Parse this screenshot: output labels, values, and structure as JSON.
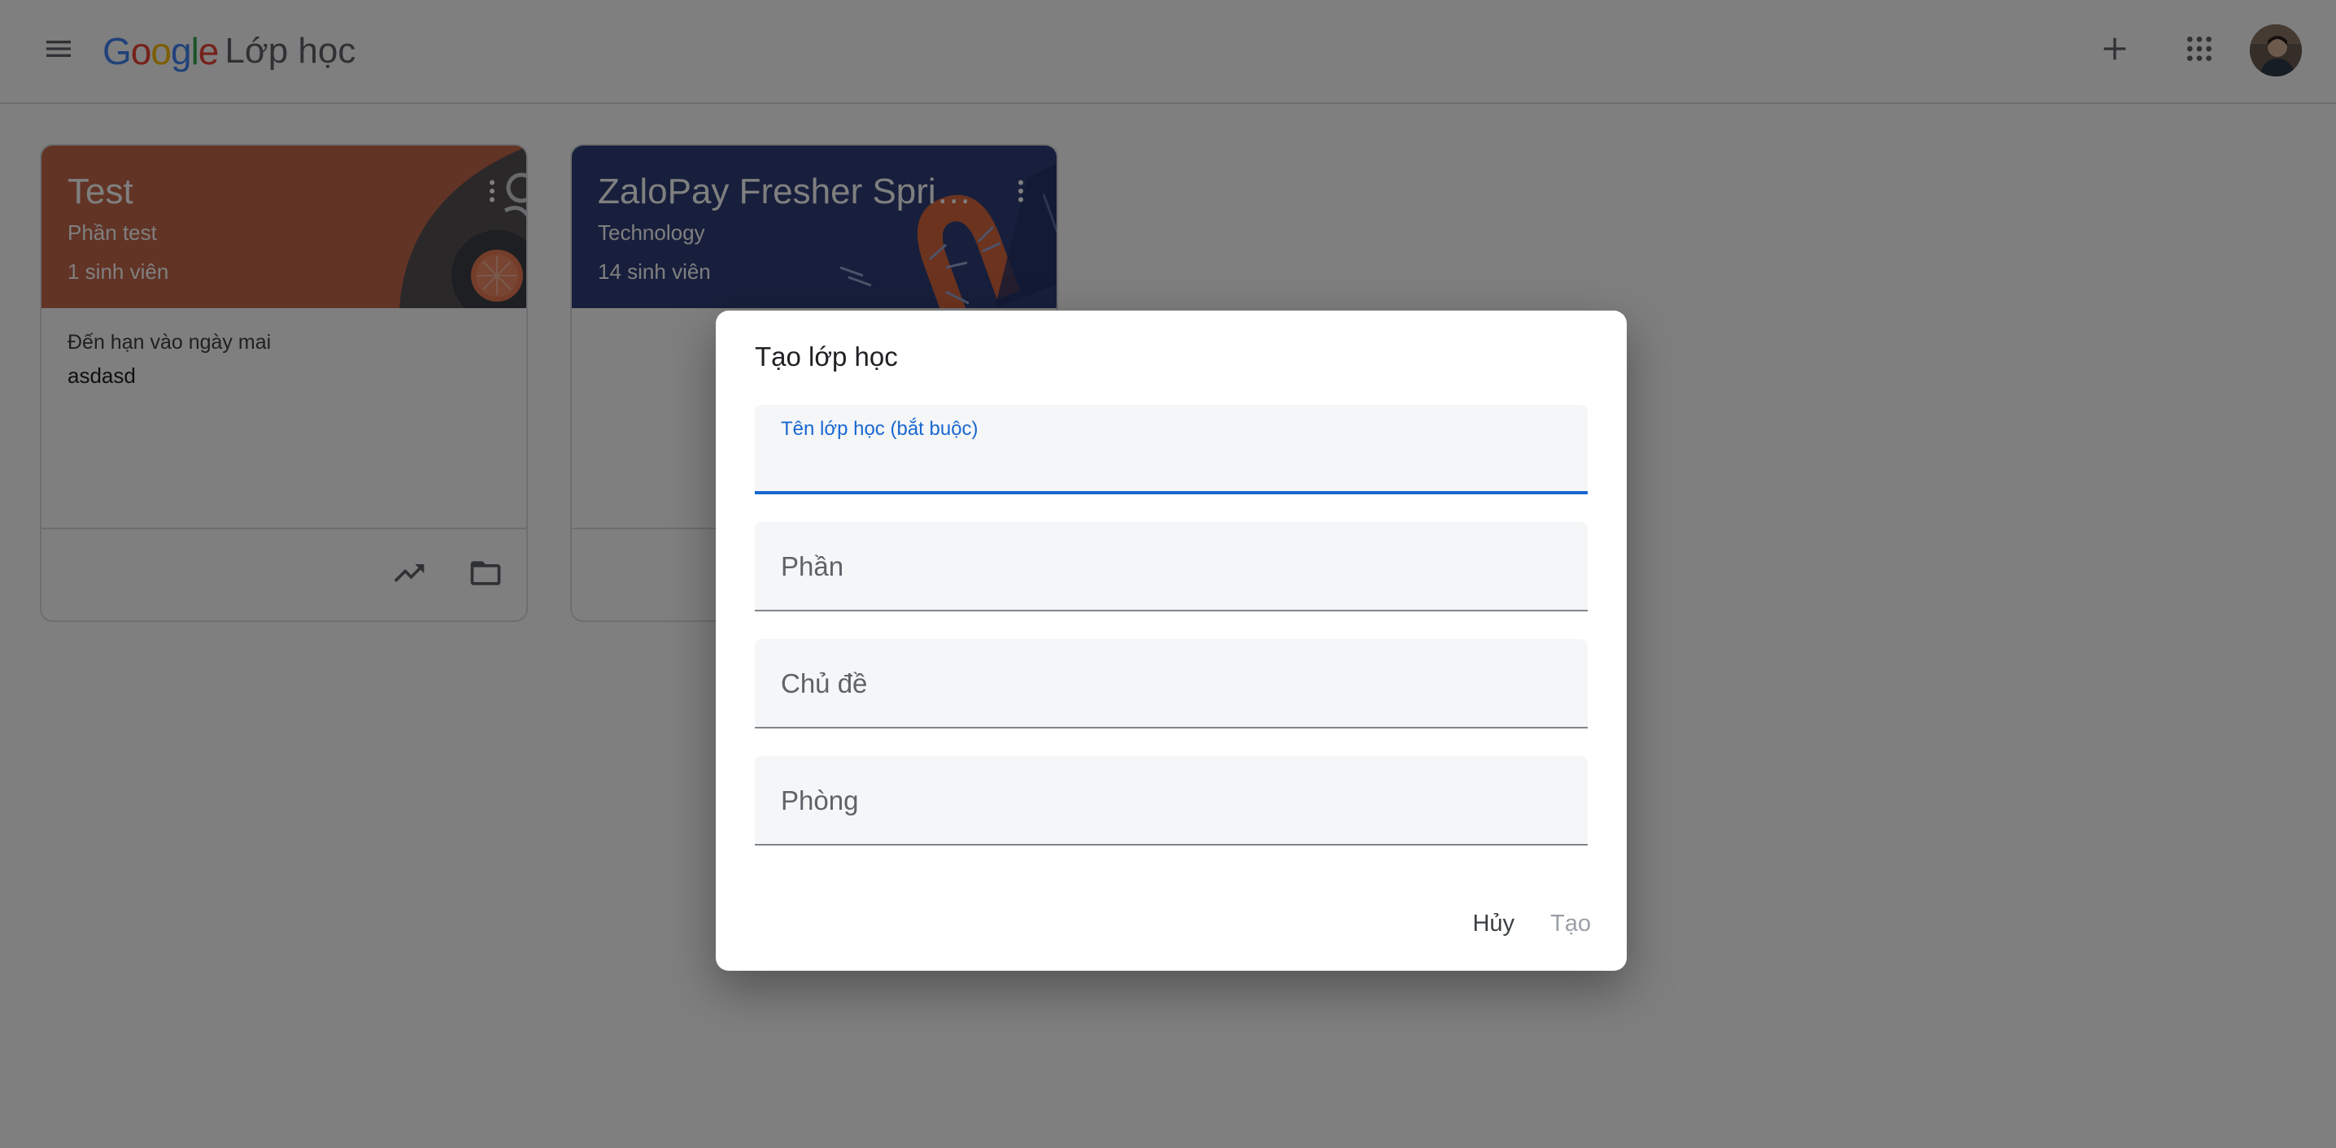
{
  "app": {
    "logo_letters": [
      "G",
      "o",
      "o",
      "g",
      "l",
      "e"
    ],
    "logo_colors": [
      "#4285F4",
      "#EA4335",
      "#FBBC05",
      "#4285F4",
      "#34A853",
      "#EA4335"
    ],
    "product_name": "Lớp học"
  },
  "header": {
    "icons": {
      "menu": "menu-icon",
      "add": "plus-icon",
      "apps": "apps-grid-icon",
      "account": "avatar"
    }
  },
  "cards": [
    {
      "title": "Test",
      "section": "Phần test",
      "students": "1 sinh viên",
      "theme_color": "#c5694a",
      "due_label": "Đến hạn vào ngày mai",
      "due_item": "asdasd"
    },
    {
      "title": "ZaloPay Fresher Sprin...",
      "section": "Technology",
      "students": "14 sinh viên",
      "theme_color": "#2f3f78",
      "due_label": "",
      "due_item": ""
    }
  ],
  "dialog": {
    "title": "Tạo lớp học",
    "fields": [
      {
        "label": "Tên lớp học (bắt buộc)",
        "value": "",
        "active": true
      },
      {
        "label": "Phần",
        "value": ""
      },
      {
        "label": "Chủ đề",
        "value": ""
      },
      {
        "label": "Phòng",
        "value": ""
      }
    ],
    "cancel_label": "Hủy",
    "create_label": "Tạo",
    "accent_color": "#1967d2"
  }
}
